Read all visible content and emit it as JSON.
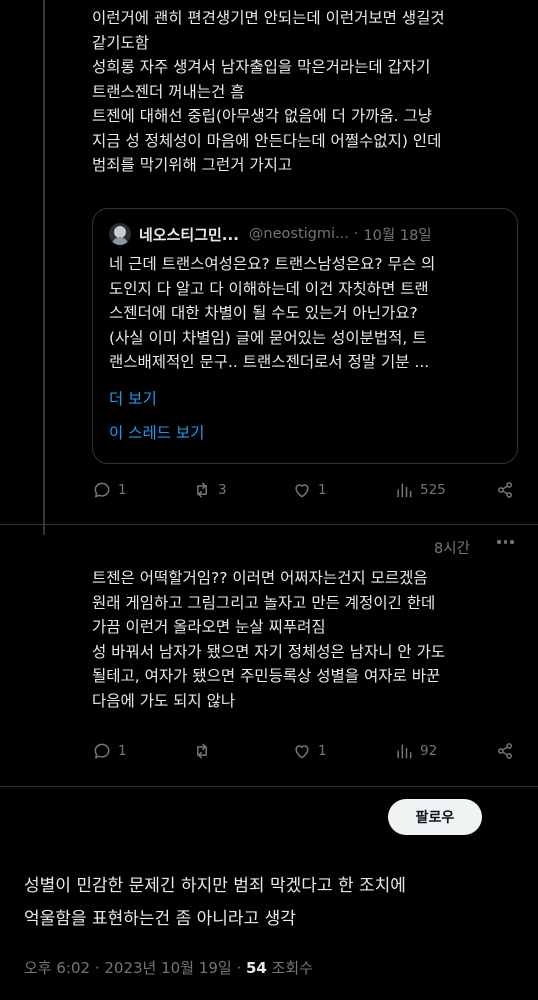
{
  "tweet1": {
    "text": "이런거에 괜히 편견생기면 안되는데 이런거보면 생길것\n같기도함\n성희롱 자주 생겨서 남자출입을 막은거라는데 갑자기\n트랜스젠더 꺼내는건 흠\n트젠에 대해선 중립(아무생각 없음에 더 가까움. 그냥\n지금 성 정체성이 마음에 안든다는데 어쩔수없지) 인데\n범죄를 막기위해 그런거 가지고",
    "quote": {
      "name": "네오스티그민...",
      "handle": "@neostigmi...",
      "dot": "·",
      "time": "10월 18일",
      "text": "네 근데 트랜스여성은요? 트랜스남성은요? 무슨 의\n도인지 다 알고 다 이해하는데 이건 자칫하면 트랜\n스젠더에 대한 차별이 될 수도 있는거 아닌가요?\n(사실 이미 차별임) 글에 묻어있는 성이분법적, 트\n랜스배제적인 문구.. 트랜스젠더로서 정말 기분 ...",
      "more": "더 보기",
      "show_thread": "이 스레드 보기"
    },
    "actions": {
      "replies": "1",
      "retweets": "3",
      "likes": "1",
      "views": "525"
    }
  },
  "tweet2": {
    "time": "8시간",
    "text": "트젠은 어떡할거임?? 이러면 어쩌자는건지 모르겠음\n원래 게임하고 그림그리고 놀자고 만든 계정이긴 한데\n가끔 이런거 올라오면 눈살 찌푸려짐\n성 바꿔서 남자가 됐으면 자기 정체성은 남자니 안 가도\n될테고, 여자가 됐으면 주민등록상 성별을 여자로 바꾼\n다음에 가도 되지 않나",
    "actions": {
      "replies": "1",
      "retweets": "",
      "likes": "1",
      "views": "92"
    }
  },
  "follow_button": "팔로우",
  "caption": "성별이 민감한 문제긴 하지만 범죄 막겠다고 한 조치에\n억울함을 표현하는건 좀 아니라고 생각",
  "footer": {
    "time": "오후 6:02",
    "sep1": " · ",
    "date": "2023년 10월 19일",
    "sep2": " · ",
    "views_count": "54",
    "views_label": " 조회수"
  },
  "colors": {
    "background": "#000000",
    "text": "#e7e9ea",
    "muted": "#71767b",
    "link": "#1d9bf0",
    "border": "#2f3336"
  }
}
